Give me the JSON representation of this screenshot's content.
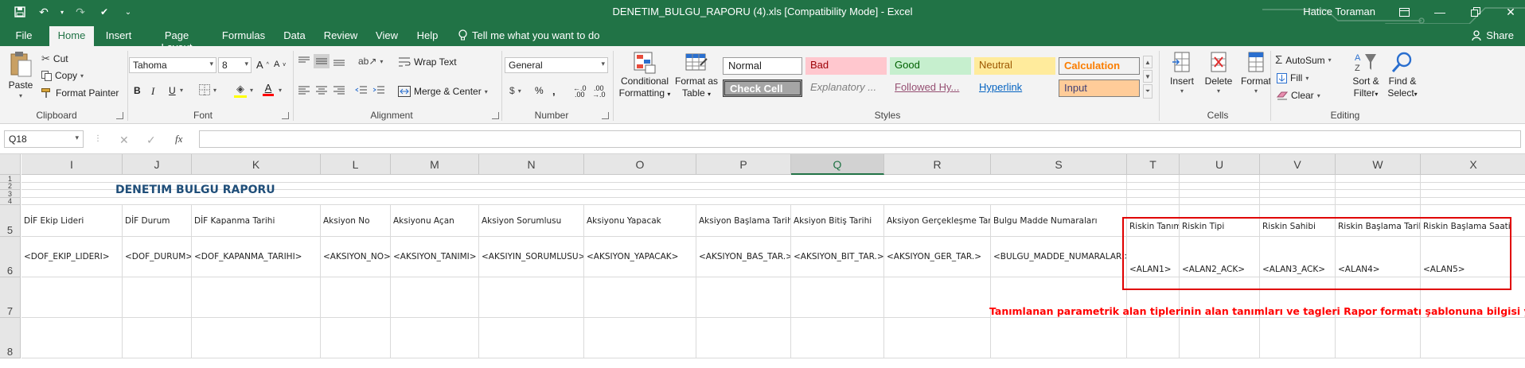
{
  "titlebar": {
    "window_title": "DENETIM_BULGU_RAPORU (4).xls  [Compatibility Mode]  -  Excel",
    "user": "Hatice Toraman"
  },
  "tabs": [
    "File",
    "Home",
    "Insert",
    "Page Layout",
    "Formulas",
    "Data",
    "Review",
    "View",
    "Help"
  ],
  "tell_me": "Tell me what you want to do",
  "share": "Share",
  "ribbon": {
    "clipboard": {
      "paste": "Paste",
      "cut": "Cut",
      "copy": "Copy",
      "format_painter": "Format Painter",
      "label": "Clipboard"
    },
    "font": {
      "name": "Tahoma",
      "size": "8",
      "bold": "B",
      "italic": "I",
      "underline": "U",
      "label": "Font"
    },
    "alignment": {
      "wrap_text": "Wrap Text",
      "merge_center": "Merge & Center",
      "label": "Alignment"
    },
    "number": {
      "format": "General",
      "label": "Number"
    },
    "styles": {
      "conditional_formatting": "Conditional Formatting",
      "conditional_l1": "Conditional",
      "conditional_l2": "Formatting",
      "format_as_table_l1": "Format as",
      "format_as_table_l2": "Table",
      "normal": "Normal",
      "bad": "Bad",
      "good": "Good",
      "neutral": "Neutral",
      "calculation": "Calculation",
      "check_cell": "Check Cell",
      "explanatory": "Explanatory ...",
      "followed": "Followed Hy...",
      "hyperlink": "Hyperlink",
      "input": "Input",
      "label": "Styles"
    },
    "cells": {
      "insert": "Insert",
      "delete": "Delete",
      "format": "Format",
      "label": "Cells"
    },
    "editing": {
      "autosum": "AutoSum",
      "fill": "Fill",
      "clear": "Clear",
      "sort_l1": "Sort &",
      "sort_l2": "Filter",
      "find_l1": "Find &",
      "find_l2": "Select",
      "label": "Editing"
    },
    "colors": {
      "font_color": "#ff0000",
      "highlight": "#ffff00"
    }
  },
  "formula_bar": {
    "name_box": "Q18",
    "formula": ""
  },
  "columns": [
    "I",
    "J",
    "K",
    "L",
    "M",
    "N",
    "O",
    "P",
    "Q",
    "R",
    "S",
    "T",
    "U",
    "V",
    "W",
    "X"
  ],
  "selected_column": "Q",
  "rows": [
    "1",
    "2",
    "3",
    "4",
    "5",
    "6",
    "7",
    "8"
  ],
  "sheet": {
    "title": "DENETIM BULGU RAPORU",
    "row5": [
      "DİF Ekip Lideri",
      "DİF Durum",
      "DİF Kapanma Tarihi",
      "Aksiyon No",
      "Aksiyonu Açan",
      "Aksiyon Sorumlusu",
      "Aksiyonu Yapacak",
      "Aksiyon Başlama Tarihi",
      "Aksiyon Bitiş     Tarihi",
      "Aksiyon Gerçekleşme Tarihi",
      "Bulgu Madde Numaraları",
      "Riskin Tanımı",
      "Riskin Tipi",
      "Riskin Sahibi",
      "Riskin Başlama Tarihi",
      "Riskin Başlama Saati"
    ],
    "row6": [
      "<DOF_EKIP_LIDERI>",
      "<DOF_DURUM>",
      "<DOF_KAPANMA_TARIHI>",
      "<AKSIYON_NO>",
      "<AKSIYON_TANIMI>",
      "<AKSIYIN_SORUMLUSU>",
      "<AKSIYON_YAPACAK>",
      "<AKSIYON_BAS_TAR.>",
      "<AKSIYON_BIT_TAR.>",
      "<AKSIYON_GER_TAR.>",
      "<BULGU_MADDE_NUMARALARI>",
      "<ALAN1>",
      "<ALAN2_ACK>",
      "<ALAN3_ACK>",
      "<ALAN4>",
      "<ALAN5>"
    ],
    "note": "Tanımlanan parametrik alan tiplerinin alan tanımları ve tagleri Rapor formatı şablonuna bilgisi yazılır."
  }
}
